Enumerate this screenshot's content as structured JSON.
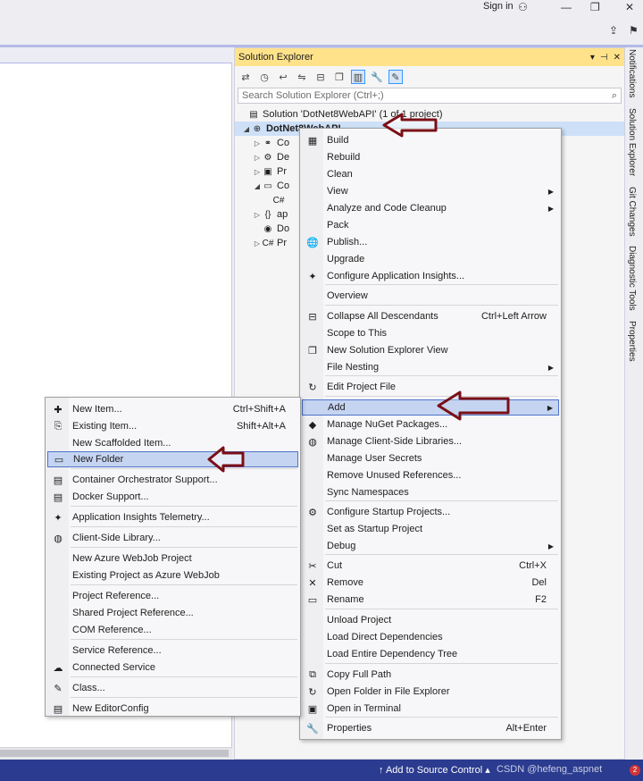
{
  "titlebar": {
    "signin": "Sign in"
  },
  "solution_explorer": {
    "title": "Solution Explorer",
    "search_placeholder": "Search Solution Explorer (Ctrl+;)",
    "solution_label": "Solution 'DotNet8WebAPI' (1 of 1 project)",
    "project_label": "DotNet8WebAPI",
    "tree": [
      {
        "indent": 1,
        "expander": "▷",
        "icon": "connected-services-icon",
        "glyph": "⚭",
        "label": "Co"
      },
      {
        "indent": 1,
        "expander": "▷",
        "icon": "dependencies-icon",
        "glyph": "⚙",
        "label": "De"
      },
      {
        "indent": 1,
        "expander": "▷",
        "icon": "properties-icon",
        "glyph": "▣",
        "label": "Pr"
      },
      {
        "indent": 1,
        "expander": "◢",
        "icon": "folder-icon",
        "glyph": "▭",
        "label": "Co"
      },
      {
        "indent": 2,
        "expander": "",
        "icon": "csharp-icon",
        "glyph": "C#",
        "label": ""
      },
      {
        "indent": 1,
        "expander": "▷",
        "icon": "json-icon",
        "glyph": "{}",
        "label": "ap"
      },
      {
        "indent": 1,
        "expander": "",
        "icon": "docker-icon",
        "glyph": "◉",
        "label": "Do"
      },
      {
        "indent": 1,
        "expander": "▷",
        "icon": "csharp-icon",
        "glyph": "C#",
        "label": "Pr"
      }
    ]
  },
  "side_tabs": [
    "Notifications",
    "Solution Explorer",
    "Git Changes",
    "Diagnostic Tools",
    "Properties"
  ],
  "statusbar": {
    "source_control": "Add to Source Control",
    "watermark": "CSDN @hefeng_aspnet",
    "badge": "2"
  },
  "context_menu": {
    "items": [
      {
        "label": "Build",
        "icon": "build-icon",
        "glyph": "▦",
        "shortcut": "",
        "submenu": false
      },
      {
        "label": "Rebuild",
        "icon": "",
        "glyph": "",
        "shortcut": "",
        "submenu": false
      },
      {
        "label": "Clean",
        "icon": "",
        "glyph": "",
        "shortcut": "",
        "submenu": false
      },
      {
        "label": "View",
        "icon": "",
        "glyph": "",
        "shortcut": "",
        "submenu": true
      },
      {
        "label": "Analyze and Code Cleanup",
        "icon": "",
        "glyph": "",
        "shortcut": "",
        "submenu": true
      },
      {
        "label": "Pack",
        "icon": "",
        "glyph": "",
        "shortcut": "",
        "submenu": false
      },
      {
        "label": "Publish...",
        "icon": "globe-icon",
        "glyph": "🌐",
        "shortcut": "",
        "submenu": false
      },
      {
        "label": "Upgrade",
        "icon": "",
        "glyph": "",
        "shortcut": "",
        "submenu": false
      },
      {
        "label": "Configure Application Insights...",
        "icon": "insights-icon",
        "glyph": "✦",
        "shortcut": "",
        "submenu": false
      },
      {
        "label": "Overview",
        "icon": "",
        "glyph": "",
        "shortcut": "",
        "submenu": false
      },
      {
        "label": "Collapse All Descendants",
        "icon": "collapse-icon",
        "glyph": "⊟",
        "shortcut": "Ctrl+Left Arrow",
        "submenu": false
      },
      {
        "label": "Scope to This",
        "icon": "",
        "glyph": "",
        "shortcut": "",
        "submenu": false
      },
      {
        "label": "New Solution Explorer View",
        "icon": "new-view-icon",
        "glyph": "❐",
        "shortcut": "",
        "submenu": false
      },
      {
        "label": "File Nesting",
        "icon": "",
        "glyph": "",
        "shortcut": "",
        "submenu": true
      },
      {
        "label": "Edit Project File",
        "icon": "edit-icon",
        "glyph": "↻",
        "shortcut": "",
        "submenu": false
      },
      {
        "label": "Add",
        "icon": "",
        "glyph": "",
        "shortcut": "",
        "submenu": true
      },
      {
        "label": "Manage NuGet Packages...",
        "icon": "nuget-icon",
        "glyph": "◆",
        "shortcut": "",
        "submenu": false
      },
      {
        "label": "Manage Client-Side Libraries...",
        "icon": "library-icon",
        "glyph": "◍",
        "shortcut": "",
        "submenu": false
      },
      {
        "label": "Manage User Secrets",
        "icon": "",
        "glyph": "",
        "shortcut": "",
        "submenu": false
      },
      {
        "label": "Remove Unused References...",
        "icon": "",
        "glyph": "",
        "shortcut": "",
        "submenu": false
      },
      {
        "label": "Sync Namespaces",
        "icon": "",
        "glyph": "",
        "shortcut": "",
        "submenu": false
      },
      {
        "label": "Configure Startup Projects...",
        "icon": "settings-icon",
        "glyph": "⚙",
        "shortcut": "",
        "submenu": false
      },
      {
        "label": "Set as Startup Project",
        "icon": "",
        "glyph": "",
        "shortcut": "",
        "submenu": false
      },
      {
        "label": "Debug",
        "icon": "",
        "glyph": "",
        "shortcut": "",
        "submenu": true
      },
      {
        "label": "Cut",
        "icon": "cut-icon",
        "glyph": "✂",
        "shortcut": "Ctrl+X",
        "submenu": false
      },
      {
        "label": "Remove",
        "icon": "remove-icon",
        "glyph": "✕",
        "shortcut": "Del",
        "submenu": false
      },
      {
        "label": "Rename",
        "icon": "rename-icon",
        "glyph": "▭",
        "shortcut": "F2",
        "submenu": false
      },
      {
        "label": "Unload Project",
        "icon": "",
        "glyph": "",
        "shortcut": "",
        "submenu": false
      },
      {
        "label": "Load Direct Dependencies",
        "icon": "",
        "glyph": "",
        "shortcut": "",
        "submenu": false
      },
      {
        "label": "Load Entire Dependency Tree",
        "icon": "",
        "glyph": "",
        "shortcut": "",
        "submenu": false
      },
      {
        "label": "Copy Full Path",
        "icon": "copy-icon",
        "glyph": "⧉",
        "shortcut": "",
        "submenu": false
      },
      {
        "label": "Open Folder in File Explorer",
        "icon": "open-folder-icon",
        "glyph": "↻",
        "shortcut": "",
        "submenu": false
      },
      {
        "label": "Open in Terminal",
        "icon": "terminal-icon",
        "glyph": "▣",
        "shortcut": "",
        "submenu": false
      },
      {
        "label": "Properties",
        "icon": "wrench-icon",
        "glyph": "🔧",
        "shortcut": "Alt+Enter",
        "submenu": false
      }
    ]
  },
  "add_submenu": {
    "items": [
      {
        "label": "New Item...",
        "icon": "new-item-icon",
        "glyph": "✚",
        "shortcut": "Ctrl+Shift+A"
      },
      {
        "label": "Existing Item...",
        "icon": "existing-item-icon",
        "glyph": "⎘",
        "shortcut": "Shift+Alt+A"
      },
      {
        "label": "New Scaffolded Item...",
        "icon": "",
        "glyph": "",
        "shortcut": ""
      },
      {
        "label": "New Folder",
        "icon": "folder-icon",
        "glyph": "▭",
        "shortcut": ""
      },
      {
        "label": "Container Orchestrator Support...",
        "icon": "container-icon",
        "glyph": "▤",
        "shortcut": ""
      },
      {
        "label": "Docker Support...",
        "icon": "docker-icon",
        "glyph": "▤",
        "shortcut": ""
      },
      {
        "label": "Application Insights Telemetry...",
        "icon": "insights-icon",
        "glyph": "✦",
        "shortcut": ""
      },
      {
        "label": "Client-Side Library...",
        "icon": "library-icon",
        "glyph": "◍",
        "shortcut": ""
      },
      {
        "label": "New Azure WebJob Project",
        "icon": "",
        "glyph": "",
        "shortcut": ""
      },
      {
        "label": "Existing Project as Azure WebJob",
        "icon": "",
        "glyph": "",
        "shortcut": ""
      },
      {
        "label": "Project Reference...",
        "icon": "",
        "glyph": "",
        "shortcut": ""
      },
      {
        "label": "Shared Project Reference...",
        "icon": "",
        "glyph": "",
        "shortcut": ""
      },
      {
        "label": "COM Reference...",
        "icon": "",
        "glyph": "",
        "shortcut": ""
      },
      {
        "label": "Service Reference...",
        "icon": "",
        "glyph": "",
        "shortcut": ""
      },
      {
        "label": "Connected Service",
        "icon": "connected-service-icon",
        "glyph": "☁",
        "shortcut": ""
      },
      {
        "label": "Class...",
        "icon": "class-icon",
        "glyph": "✎",
        "shortcut": ""
      },
      {
        "label": "New EditorConfig",
        "icon": "editorconfig-icon",
        "glyph": "▤",
        "shortcut": ""
      }
    ]
  },
  "colors": {
    "arrow": "#7a0f16",
    "highlight": "#c5d4f1",
    "statusbar": "#2b3b8f",
    "panel_title": "#ffe28a"
  }
}
